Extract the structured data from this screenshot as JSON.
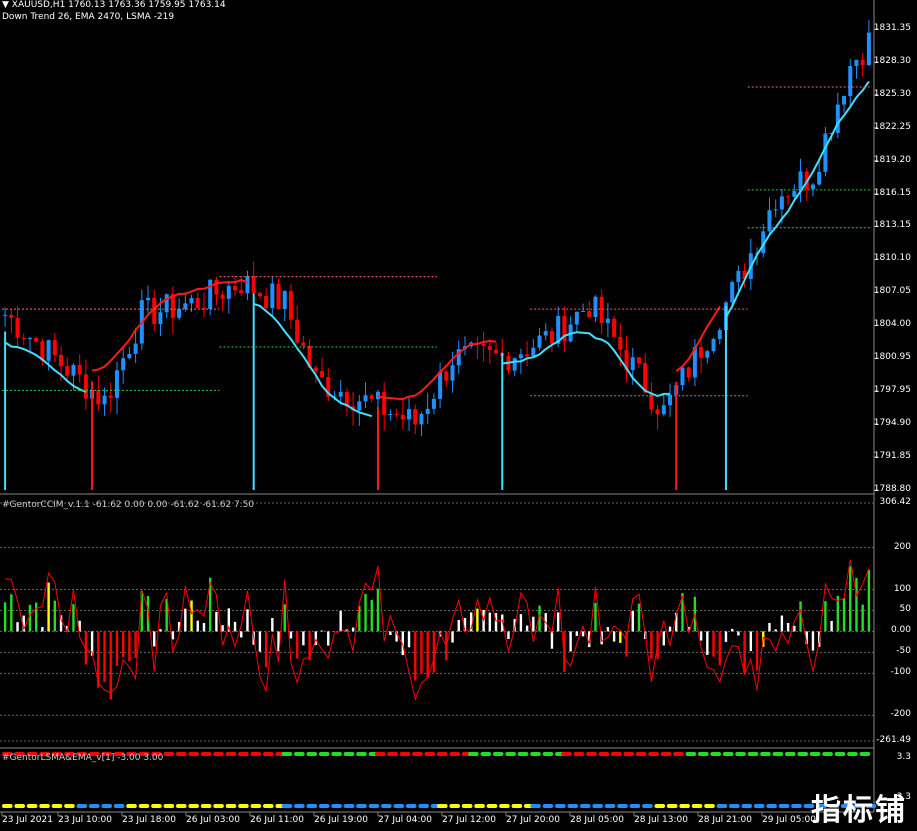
{
  "header": {
    "symbol_line": "XAUUSD,H1  1760.13 1763.36 1759.95 1763.14",
    "indicators_line": "Down Trend 26,  EMA 2470,  LSMA -219"
  },
  "price_axis": [
    "1831.35",
    "1828.30",
    "1825.30",
    "1822.25",
    "1819.20",
    "1816.15",
    "1813.15",
    "1810.10",
    "1807.05",
    "1804.00",
    "1800.95",
    "1797.95",
    "1794.90",
    "1791.85",
    "1788.80"
  ],
  "cci_panel": {
    "label": "#GentorCCIM_v.1.1 -61.62 0.00 0.00 -61.62 -61.62 7.50",
    "axis": [
      {
        "text": "306.42",
        "v": 306.42
      },
      {
        "text": "200",
        "v": 200
      },
      {
        "text": "100",
        "v": 100
      },
      {
        "text": "50",
        "v": 50
      },
      {
        "text": "0.00",
        "v": 0
      },
      {
        "text": "-50",
        "v": -50
      },
      {
        "text": "-100",
        "v": -100
      },
      {
        "text": "-200",
        "v": -200
      },
      {
        "text": "-261.49",
        "v": -261.49
      }
    ]
  },
  "lsma_panel": {
    "label": "#GentorLSMA&EMA_v[1] -3.00 3.00",
    "axis": [
      "3.3",
      "-3.3"
    ]
  },
  "time_axis": [
    "23 Jul 2021",
    "23 Jul 10:00",
    "23 Jul 18:00",
    "26 Jul 03:00",
    "26 Jul 11:00",
    "26 Jul 19:00",
    "27 Jul 04:00",
    "27 Jul 12:00",
    "27 Jul 20:00",
    "28 Jul 05:00",
    "28 Jul 13:00",
    "28 Jul 21:00",
    "29 Jul 05:00"
  ],
  "watermark": "指标铺",
  "colors": {
    "bull": "#1e90ff",
    "bear": "#ff0000",
    "ema": "#ff1a1a",
    "lsma": "#40e0ff",
    "green": "#22dd22",
    "yellow": "#ffff00",
    "white": "#ffffff"
  }
}
